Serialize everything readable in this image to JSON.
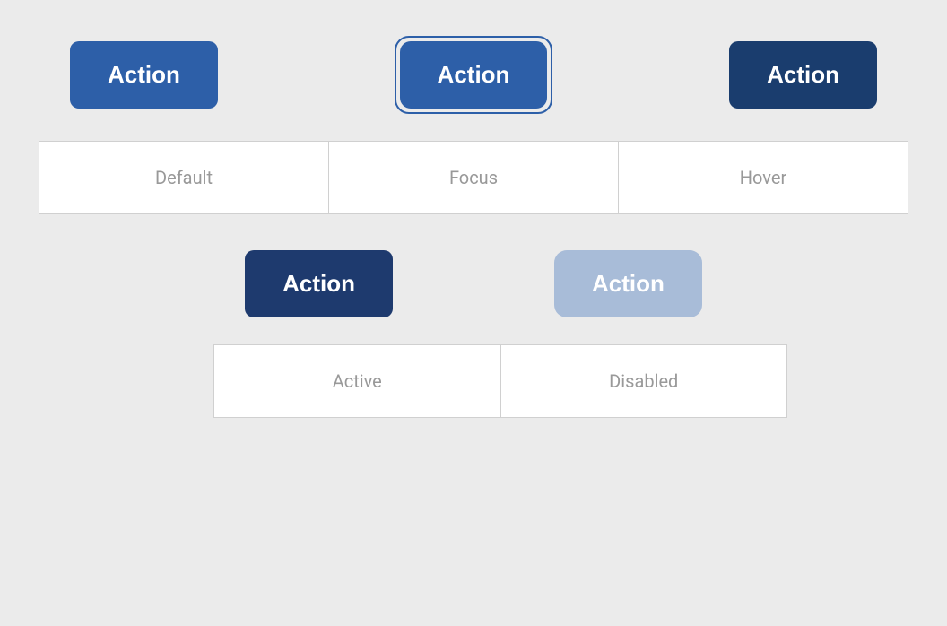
{
  "buttons": {
    "default": {
      "label": "Action",
      "state": "default"
    },
    "focus": {
      "label": "Action",
      "state": "focus"
    },
    "hover": {
      "label": "Action",
      "state": "hover"
    },
    "active": {
      "label": "Action",
      "state": "active"
    },
    "disabled": {
      "label": "Action",
      "state": "disabled"
    }
  },
  "labels": {
    "top": {
      "col1": "Default",
      "col2": "Focus",
      "col3": "Hover"
    },
    "bottom": {
      "col1": "Active",
      "col2": "Disabled"
    }
  }
}
